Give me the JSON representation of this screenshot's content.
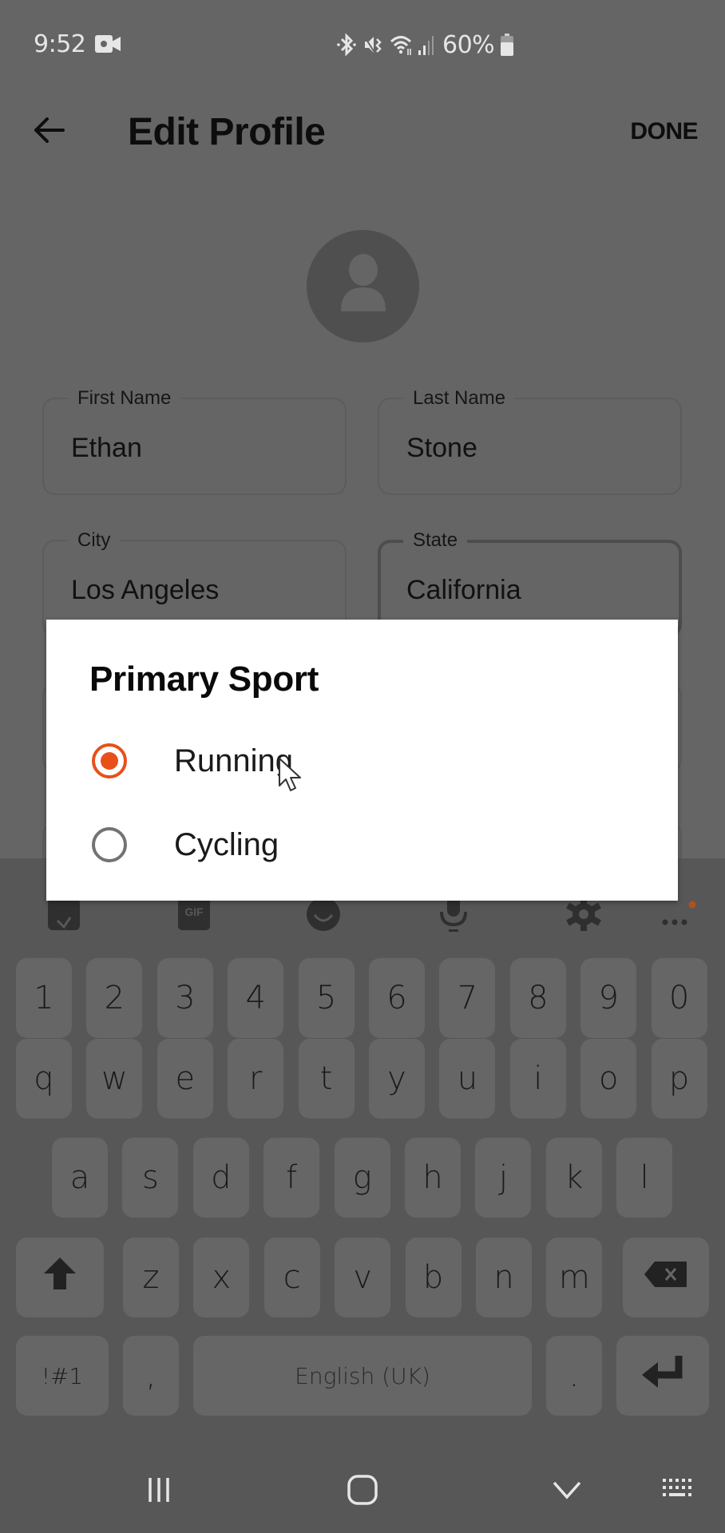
{
  "status_bar": {
    "time": "9:52",
    "battery_percent": "60%",
    "icons": [
      "video-recording-icon",
      "bluetooth-icon",
      "mute-vibrate-icon",
      "wifi-icon",
      "signal-icon",
      "battery-icon"
    ]
  },
  "app_bar": {
    "back_icon": "arrow-left-icon",
    "title": "Edit Profile",
    "done_label": "DONE"
  },
  "avatar": {
    "icon": "person-icon"
  },
  "form": {
    "first_name": {
      "label": "First Name",
      "value": "Ethan"
    },
    "last_name": {
      "label": "Last Name",
      "value": "Stone"
    },
    "city": {
      "label": "City",
      "value": "Los Angeles"
    },
    "state": {
      "label": "State",
      "value": "California"
    }
  },
  "dialog": {
    "title": "Primary Sport",
    "options": [
      {
        "label": "Running",
        "selected": true
      },
      {
        "label": "Cycling",
        "selected": false
      }
    ],
    "accent_color": "#e8501a"
  },
  "keyboard": {
    "toolbar_icons": [
      "sticker-icon",
      "gif-icon",
      "emoji-icon",
      "microphone-icon",
      "settings-gear-icon",
      "more-icon"
    ],
    "gif_label": "GIF",
    "rows": [
      [
        "1",
        "2",
        "3",
        "4",
        "5",
        "6",
        "7",
        "8",
        "9",
        "0"
      ],
      [
        "q",
        "w",
        "e",
        "r",
        "t",
        "y",
        "u",
        "i",
        "o",
        "p"
      ],
      [
        "a",
        "s",
        "d",
        "f",
        "g",
        "h",
        "j",
        "k",
        "l"
      ],
      [
        "z",
        "x",
        "c",
        "v",
        "b",
        "n",
        "m"
      ]
    ],
    "symbols_label": "!#1",
    "comma_label": ",",
    "space_label": "English (UK)",
    "period_label": "."
  },
  "nav_bar": {
    "icons": [
      "recent-apps-icon",
      "home-icon",
      "hide-keyboard-icon",
      "keyboard-switch-icon"
    ]
  }
}
